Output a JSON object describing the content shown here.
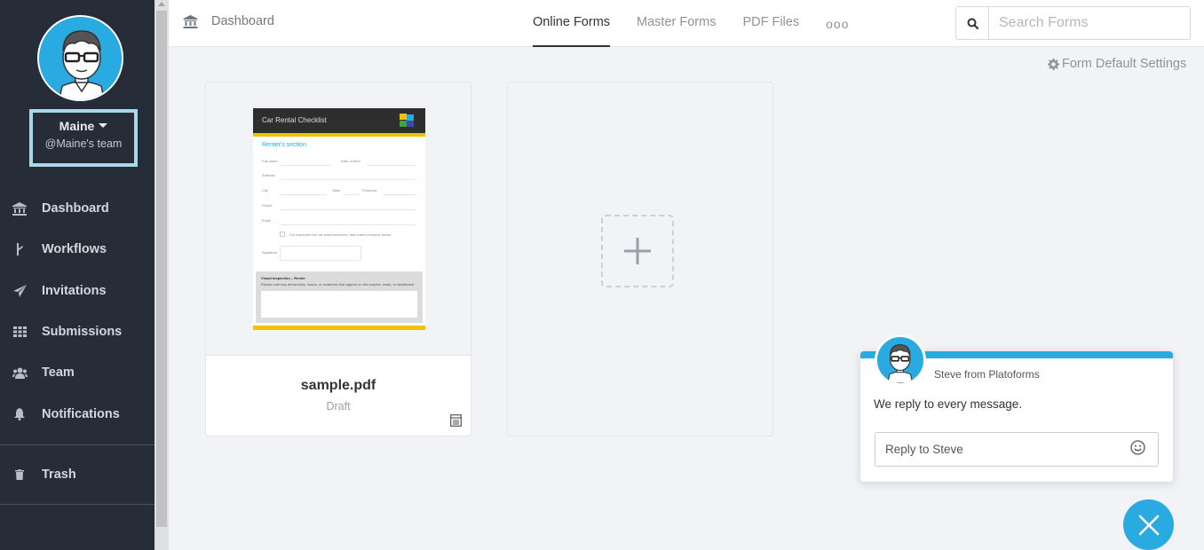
{
  "user": {
    "name": "Maine",
    "team": "@Maine's team"
  },
  "sidebar": {
    "items": [
      {
        "label": "Dashboard",
        "icon": "bank-icon"
      },
      {
        "label": "Workflows",
        "icon": "branch-icon"
      },
      {
        "label": "Invitations",
        "icon": "paper-plane-icon"
      },
      {
        "label": "Submissions",
        "icon": "grid-icon"
      },
      {
        "label": "Team",
        "icon": "users-icon"
      },
      {
        "label": "Notifications",
        "icon": "bell-icon"
      }
    ],
    "trash": {
      "label": "Trash",
      "icon": "trash-icon"
    }
  },
  "header": {
    "breadcrumb": "Dashboard",
    "tabs": [
      "Online Forms",
      "Master Forms",
      "PDF Files"
    ],
    "more": "ooo",
    "search_placeholder": "Search Forms"
  },
  "settings_link": "Form Default Settings",
  "form_card": {
    "name": "sample.pdf",
    "status": "Draft",
    "preview": {
      "title": "Car Rental Checklist",
      "section": "Renter's section",
      "labels": [
        "Full name",
        "Date of birth",
        "Address",
        "City",
        "State",
        "Postcode",
        "Phone",
        "Email",
        "I've inspected the car exterior/interior, and noted concerns below",
        "Signature"
      ],
      "inspection_title": "Visual Inspection – Renter",
      "inspection_text": "Please note any dents/chips, stains, or scratches that appear on the carpets, seats, or dashboard"
    }
  },
  "chat": {
    "from": "Steve from Platoforms",
    "message": "We reply to every message.",
    "reply_placeholder": "Reply to Steve"
  },
  "colors": {
    "sidebar": "#262d38",
    "accent": "#29abe2",
    "highlight": "#a8d8ea",
    "doc_yellow": "#f2c200"
  }
}
